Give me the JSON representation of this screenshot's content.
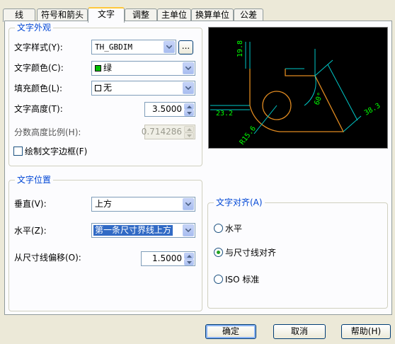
{
  "tabs": [
    "线",
    "符号和箭头",
    "文字",
    "调整",
    "主单位",
    "换算单位",
    "公差"
  ],
  "active_tab": "文字",
  "text_appearance": {
    "title": "文字外观",
    "style_label": "文字样式(Y):",
    "style_value": "TH_GBDIM",
    "browse_label": "...",
    "color_label": "文字颜色(C):",
    "color_value": "绿",
    "color_swatch": "#00c000",
    "fill_label": "填充颜色(L):",
    "fill_value": "无",
    "height_label": "文字高度(T):",
    "height_value": "3.5000",
    "fraction_label": "分数高度比例(H):",
    "fraction_value": "0.714286",
    "frame_label": "绘制文字边框(F)"
  },
  "text_placement": {
    "title": "文字位置",
    "vertical_label": "垂直(V):",
    "vertical_value": "上方",
    "horizontal_label": "水平(Z):",
    "horizontal_value": "第一条尺寸界线上方",
    "offset_label": "从尺寸线偏移(O):",
    "offset_value": "1.5000"
  },
  "text_alignment": {
    "title": "文字对齐(A)",
    "options": [
      "水平",
      "与尺寸线对齐",
      "ISO 标准"
    ],
    "selected": "与尺寸线对齐"
  },
  "preview_labels": {
    "dim_top": "19.8",
    "dim_left": "23.2",
    "dim_angle": "60°",
    "dim_right": "38.3",
    "dim_radius": "R15.6"
  },
  "buttons": {
    "ok": "确定",
    "cancel": "取消",
    "help": "帮助(H)"
  },
  "colors": {
    "accent": "#0046d5",
    "preview_bg": "#000000",
    "dim_line": "#00c8c8",
    "dim_text": "#00ff00",
    "geometry": "#e08a20"
  }
}
